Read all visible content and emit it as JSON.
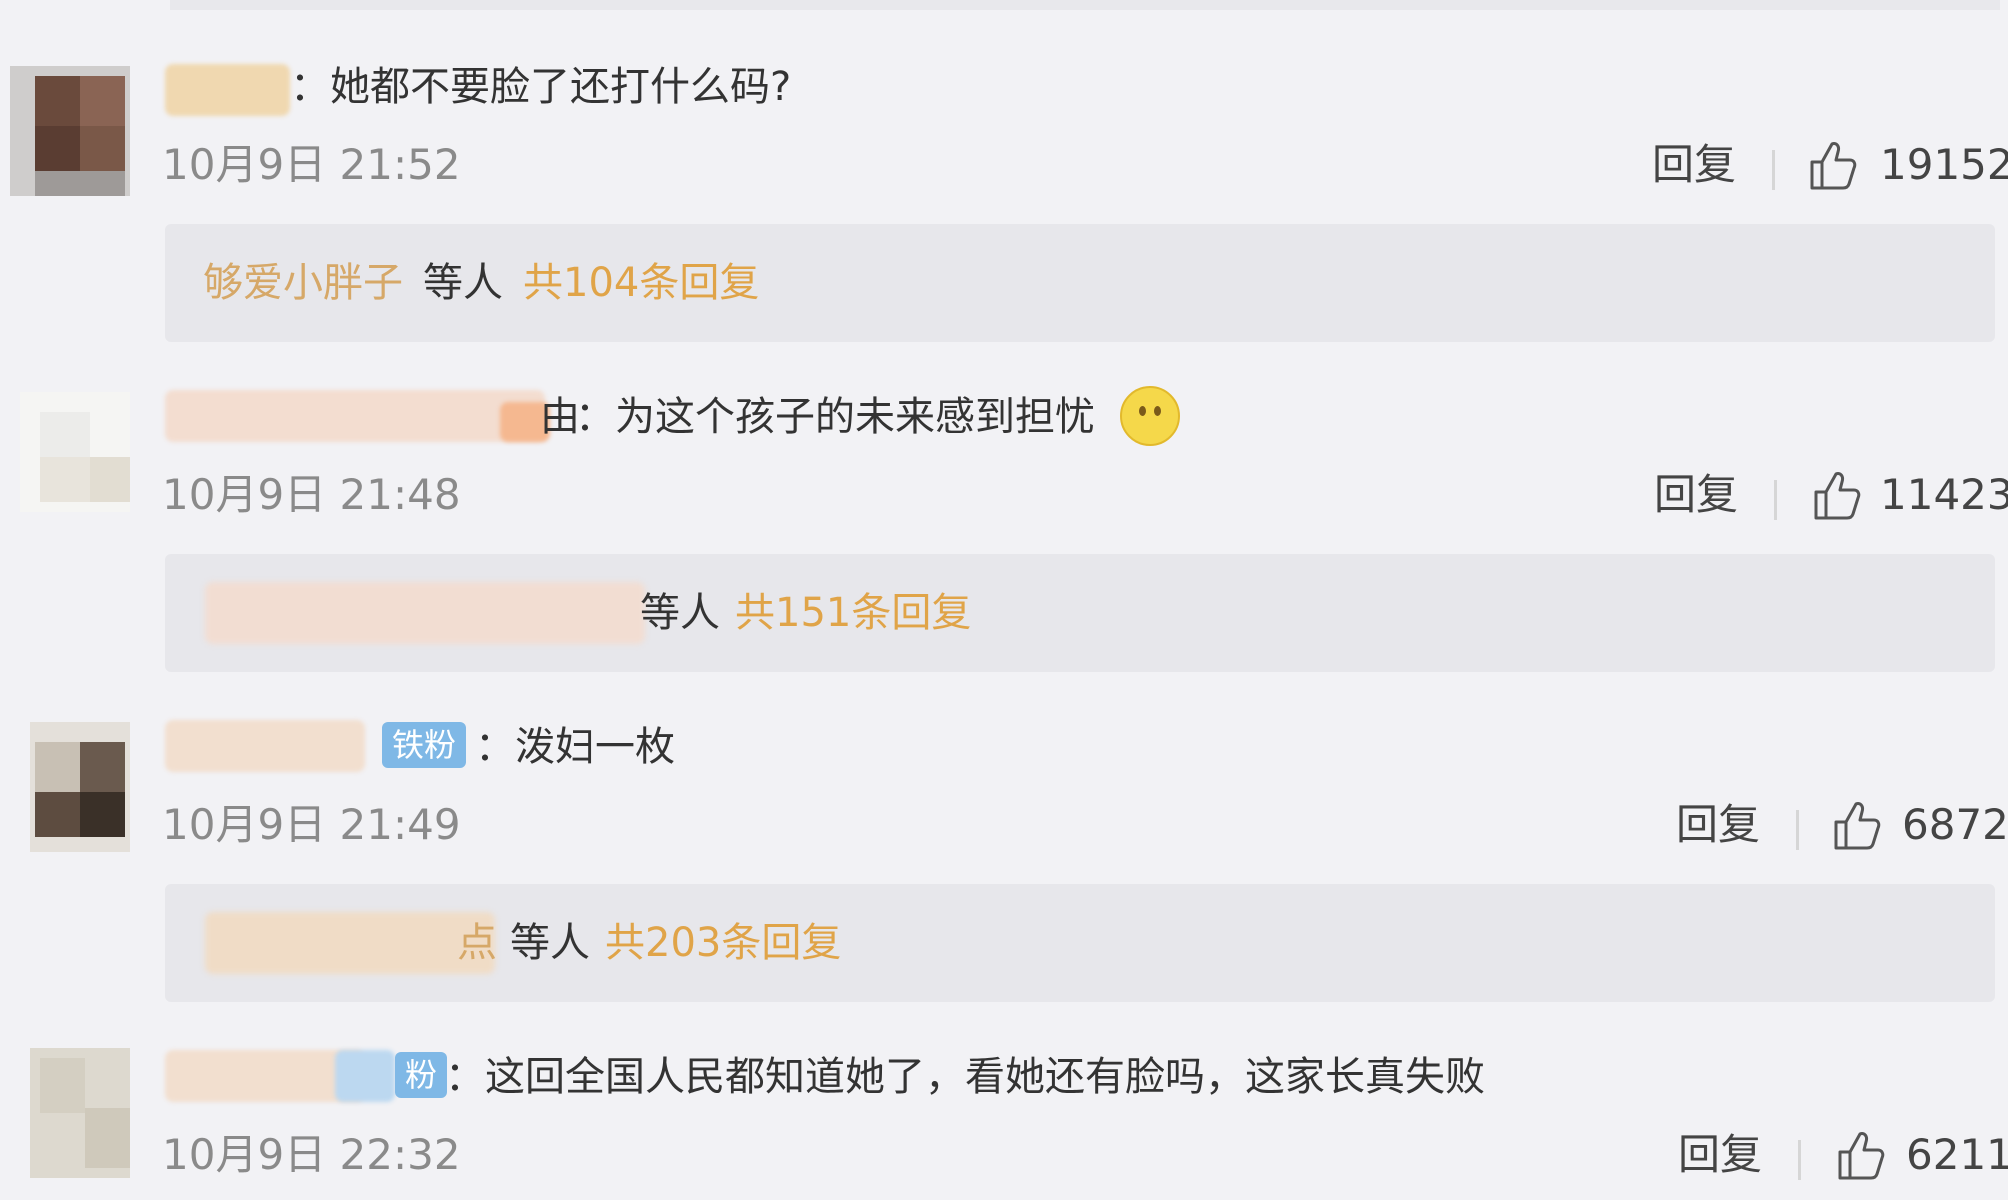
{
  "colors": {
    "background": "#f2f2f5",
    "reply_box": "#e7e7eb",
    "name_link": "#d6a868",
    "reply_total": "#e0a448",
    "badge": "#7fb8e6",
    "timestamp": "#8a8a8a"
  },
  "icons": {
    "like": "thumbs-up-icon",
    "emoji": "worried-face-emoji"
  },
  "comments": [
    {
      "text": "：她都不要脸了还打什么码?",
      "time": "10月9日 21:52",
      "reply_label": "回复",
      "likes": "19152",
      "replies": {
        "name": "够爱小胖子",
        "suffix": "等人",
        "total": "共104条回复"
      }
    },
    {
      "name_tail": "由",
      "text": "：为这个孩子的未来感到担忧",
      "time": "10月9日 21:48",
      "reply_label": "回复",
      "likes": "11423",
      "replies": {
        "suffix": "等人",
        "total": "共151条回复"
      }
    },
    {
      "badge": "铁粉",
      "text": "：泼妇一枚",
      "time": "10月9日 21:49",
      "reply_label": "回复",
      "likes": "6872",
      "replies": {
        "name_tail": "点",
        "suffix": "等人",
        "total": "共203条回复"
      }
    },
    {
      "badge": "粉",
      "text": "：这回全国人民都知道她了，看她还有脸吗，这家长真失败",
      "time": "10月9日 22:32",
      "reply_label": "回复",
      "likes": "6211"
    }
  ]
}
